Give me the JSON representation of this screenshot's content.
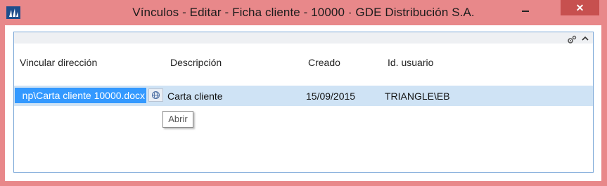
{
  "window": {
    "title": "Vínculos - Editar - Ficha cliente - 10000 · GDE Distribución S.A.",
    "minimize_label": "",
    "close_label": "✕"
  },
  "table": {
    "columns": [
      "Vincular dirección",
      "Descripción",
      "Creado",
      "Id. usuario"
    ],
    "rows": [
      {
        "link": "np\\Carta cliente 10000.docx",
        "description": "Carta cliente",
        "created": "15/09/2015",
        "user_id": "TRIANGLE\\EB"
      }
    ]
  },
  "tooltip": {
    "text": "Abrir"
  },
  "icons": {
    "app": "app-logo-icon",
    "gear": "gear-icon",
    "collapse": "chevron-up-icon",
    "open": "globe-icon"
  },
  "colors": {
    "titlebar": "#e8888a",
    "close_button": "#c7504f",
    "selected_row": "#cfe3f5",
    "selection_highlight": "#3399ff",
    "panel_border": "#7aa7d8"
  }
}
